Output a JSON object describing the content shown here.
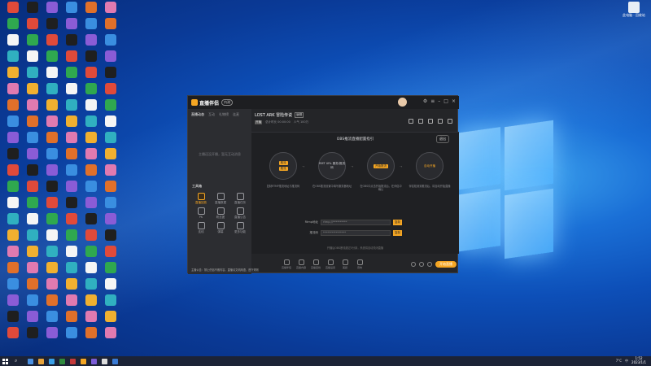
{
  "desktop": {
    "recycle_bin_label": "此电脑 · 回收站",
    "icon_rows": 25
  },
  "app": {
    "brand_name": "直播伴侣",
    "version_badge": "内测",
    "left_tabs": [
      "直播动态",
      "互动",
      "礼物榜",
      "连麦"
    ],
    "left_empty_text": "主播还没开播，暂无互动消息",
    "tools_title": "工具箱",
    "tools": [
      {
        "label": "直播回放",
        "hot": true
      },
      {
        "label": "直播数据",
        "hot": false
      },
      {
        "label": "直播任务",
        "hot": false
      },
      {
        "label": "PK",
        "hot": false
      },
      {
        "label": "粉丝团",
        "hot": false
      },
      {
        "label": "直播公告",
        "hot": false
      },
      {
        "label": "连线",
        "hot": false
      },
      {
        "label": "弹幕",
        "hot": false
      },
      {
        "label": "更多功能",
        "hot": false
      }
    ],
    "stream_title": "LOST ARK 冒险传说",
    "stream_title_tag": "编辑",
    "stream_meta": [
      "开播",
      "总计时长 00:00:00",
      "人气 100万"
    ],
    "stage_title": "OBS推流直播配置指引",
    "stage_btn": "退出",
    "steps": [
      {
        "pills": [
          "推流",
          "推流"
        ],
        "text": "",
        "desc": "复制RTMP推流地址与推流码"
      },
      {
        "pills": [],
        "text": "RMT URL 服务/推流码",
        "desc": "在OBS推流设置中填写服务器地址"
      },
      {
        "pills": [
          "开始推流"
        ],
        "text": "",
        "desc": "在OBS中点击开始推流后，在伴侣中确认"
      },
      {
        "pills": [],
        "text": "自动开播",
        "desc": "伴侣检测到推流后，将自动开始直播"
      }
    ],
    "fields": [
      {
        "label": "Rtmp地址",
        "value": "rtmp://**********",
        "btn": "复制"
      },
      {
        "label": "推流码",
        "value": "****************",
        "btn": "复制"
      }
    ],
    "stage_note": "开播后OBS断流超过5分钟，系统将自动关闭直播",
    "bottom_tools": [
      "直播伴侣",
      "直播内容",
      "直播连线",
      "直播设置",
      "美颜",
      "音效"
    ],
    "go_live_label": "开始直播",
    "left_bottom_msg": "主播公告：禁止低俗不雅内容，直播请文明用语，遵守规则"
  },
  "taskbar": {
    "search_icon": "search-icon",
    "tray_text": "中",
    "temp": "7°C",
    "time": "1:52",
    "date": "2023/1/1"
  },
  "colors": {
    "accent": "#f5a623",
    "app_bg": "#242528",
    "desktop": "#0d4fb8"
  }
}
